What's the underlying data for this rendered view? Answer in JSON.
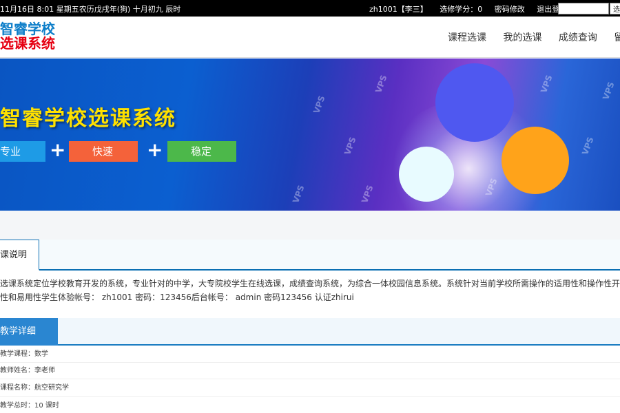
{
  "topbar": {
    "date": "11月16日 8:01 星期五农历戊戌年(狗) 十月初九 辰时",
    "user": "zh1001【李三】",
    "credits": "选修学分：0",
    "change_password": "密码修改",
    "logout": "退出登陆",
    "search_value": "",
    "search_button": "选课"
  },
  "logo": {
    "line1": "智睿学校",
    "line2": "选课系统"
  },
  "nav": {
    "items": [
      "课程选课",
      "我的选课",
      "成绩查询",
      "留言"
    ]
  },
  "banner": {
    "title": "智睿学校选课系统",
    "tags": [
      "专业",
      "快速",
      "稳定"
    ],
    "plus": "+",
    "watermark": "VPS",
    "colors": {
      "tag1": "#1e9be6",
      "tag2": "#f4623a",
      "tag3": "#4cb84a",
      "circle_blue": "#4f58f0",
      "circle_orange": "#ffa31a",
      "circle_white": "#e8fbff"
    }
  },
  "intro": {
    "tab": "课说明",
    "lines": [
      "选课系统定位学校教育开发的系统，专业针对的中学，大专院校学生在线选课，成绩查询系统，为综合一体校园信息系统。系统针对当前学校所需操作的适用性和操作性开发，增",
      "性和易用性学生体验帐号： zh1001 密码：123456后台帐号： admin 密码123456 认证zhirui"
    ]
  },
  "detail": {
    "tab": "教学详细",
    "rows": [
      "教学课程：数学",
      "教师姓名：李老师",
      "课程名称：航空研究学",
      "教学总时：10 课时"
    ]
  }
}
